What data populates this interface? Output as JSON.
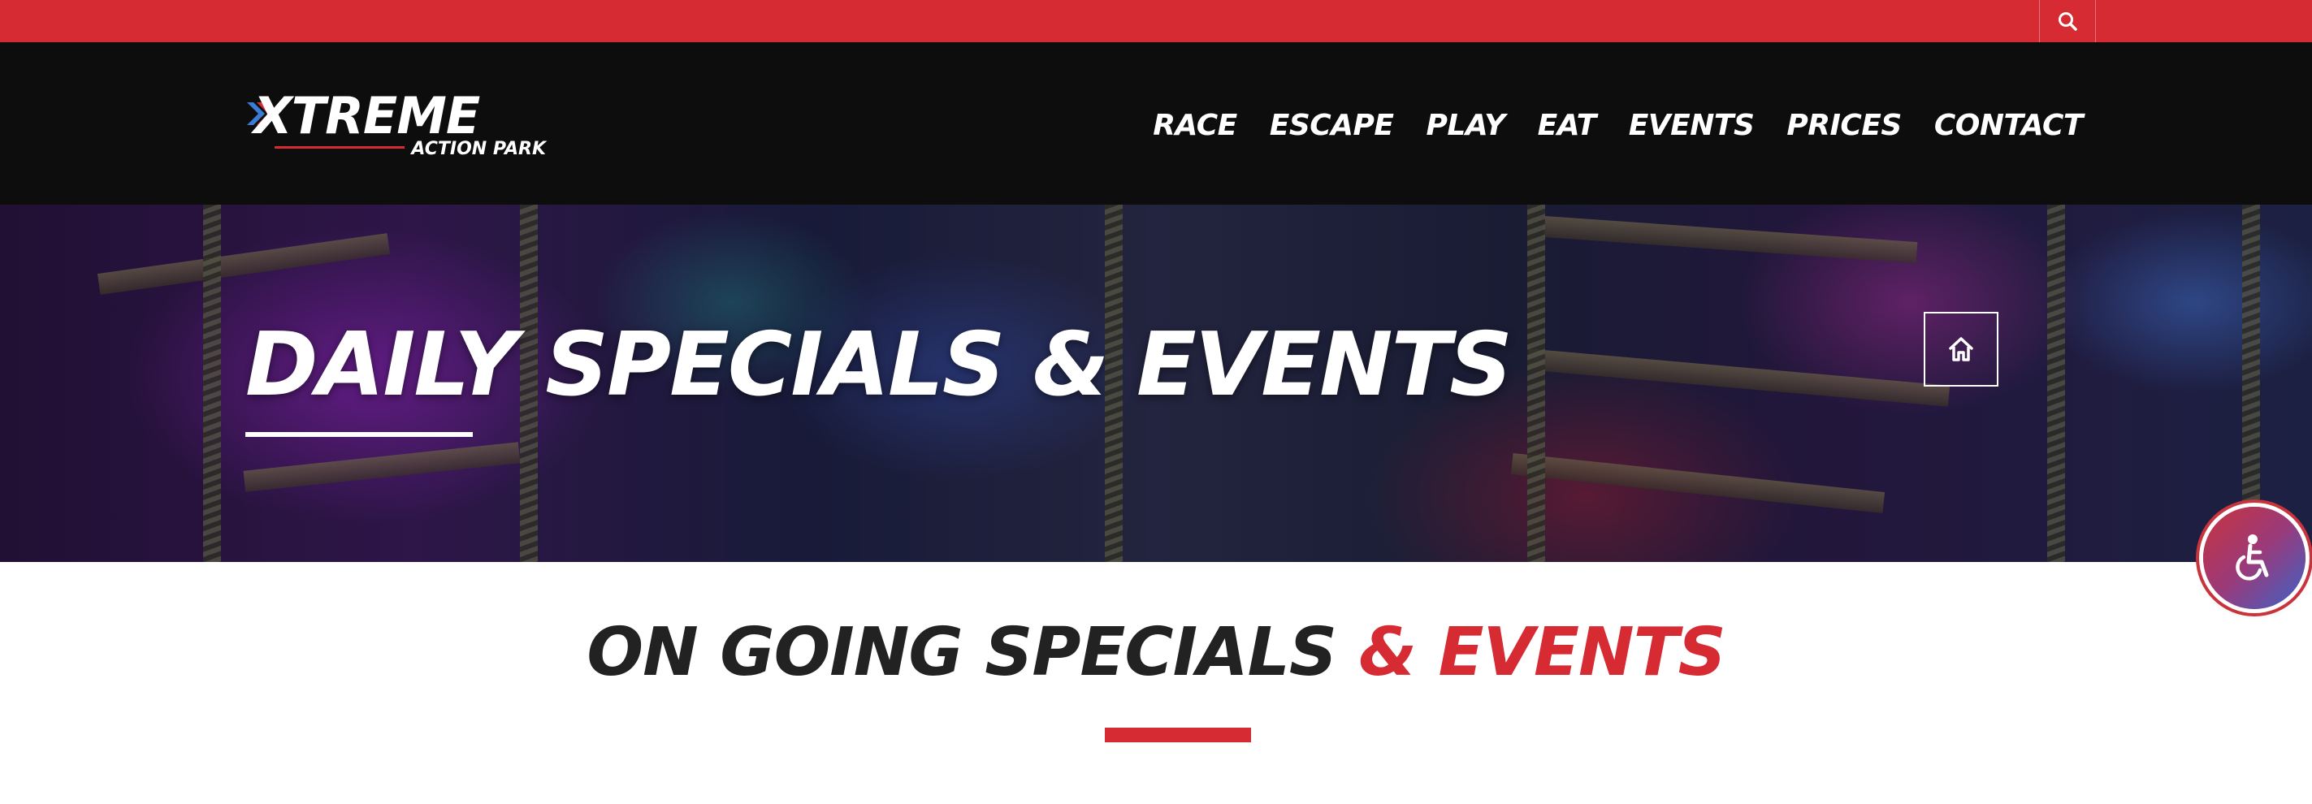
{
  "colors": {
    "brand_red": "#d62b33",
    "header_black": "#0d0d0d",
    "title_dark": "#222222"
  },
  "topbar": {
    "search_icon": "search-icon"
  },
  "logo": {
    "main": "XTREME",
    "sub": "ACTION PARK"
  },
  "nav": {
    "items": [
      {
        "label": "RACE"
      },
      {
        "label": "ESCAPE"
      },
      {
        "label": "PLAY"
      },
      {
        "label": "EAT"
      },
      {
        "label": "EVENTS"
      },
      {
        "label": "PRICES"
      },
      {
        "label": "CONTACT"
      }
    ]
  },
  "hero": {
    "title": "DAILY SPECIALS & EVENTS",
    "home_icon": "home-icon"
  },
  "section": {
    "title_main": "ON GOING SPECIALS ",
    "title_accent": "& EVENTS"
  },
  "accessibility": {
    "icon": "wheelchair-icon"
  }
}
